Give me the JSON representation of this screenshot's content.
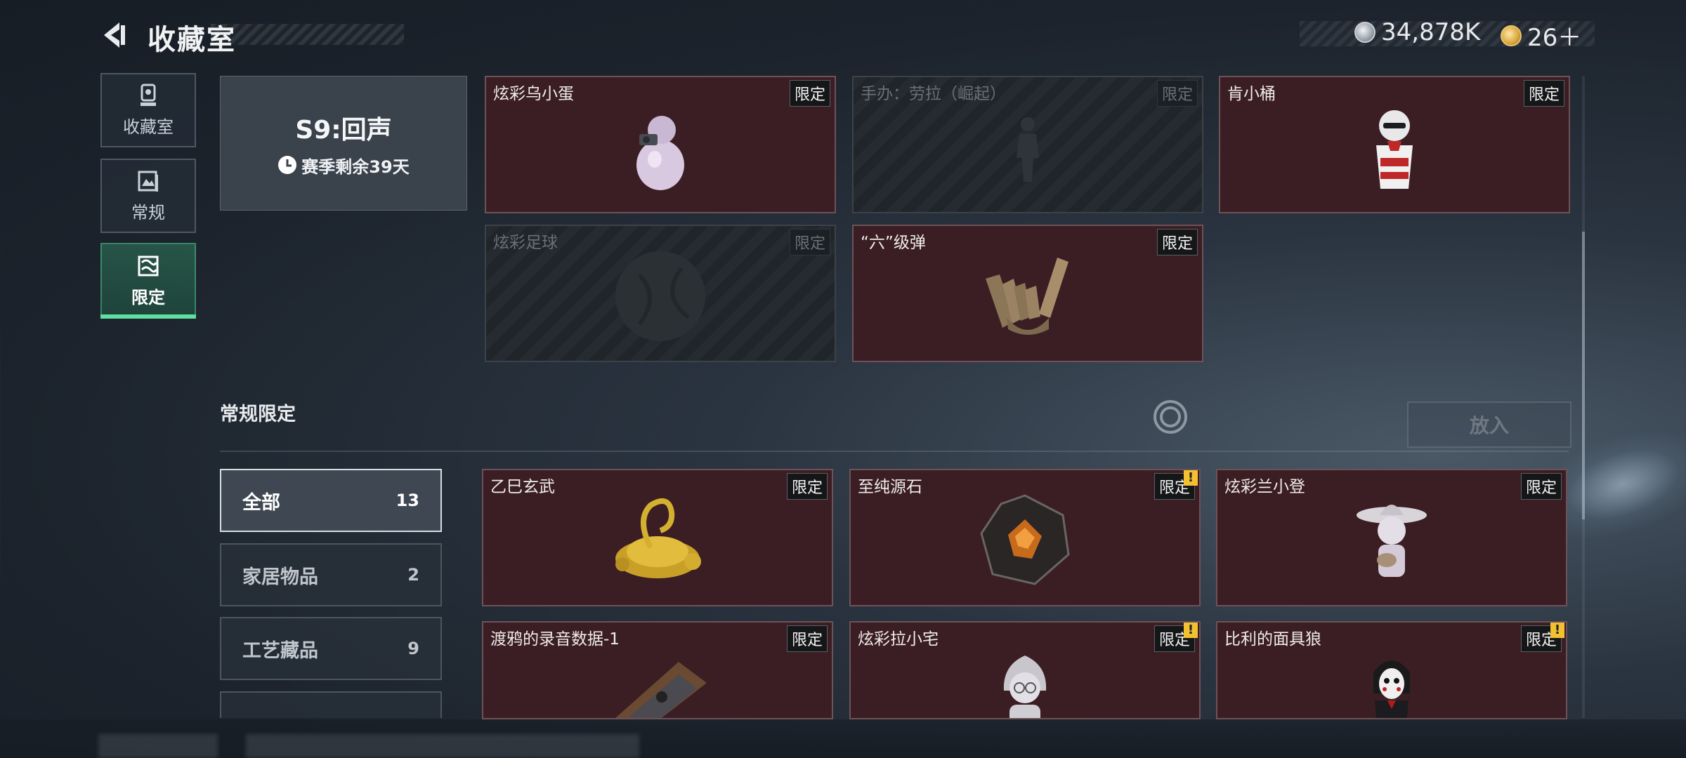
{
  "header": {
    "title": "收藏室",
    "currency_silver": "34,878K",
    "currency_gold": "26＋"
  },
  "nav": [
    {
      "label": "收藏室",
      "icon": "trophy-icon"
    },
    {
      "label": "常规",
      "icon": "frame-icon"
    },
    {
      "label": "限定",
      "icon": "limited-icon"
    }
  ],
  "season": {
    "title": "S9:回声",
    "remaining": "赛季剩余39天"
  },
  "season_items": [
    {
      "name": "炫彩乌小蛋",
      "tag": "限定",
      "locked": false,
      "alert": false,
      "icon": "egg-figure-icon"
    },
    {
      "name": "手办：劳拉（崛起）",
      "tag": "限定",
      "locked": true,
      "alert": false,
      "icon": "figure-silhouette-icon"
    },
    {
      "name": "肯小桶",
      "tag": "限定",
      "locked": false,
      "alert": false,
      "icon": "bucket-figure-icon"
    },
    {
      "name": "炫彩足球",
      "tag": "限定",
      "locked": true,
      "alert": false,
      "icon": "ball-silhouette-icon"
    },
    {
      "name": "“六”级弹",
      "tag": "限定",
      "locked": false,
      "alert": false,
      "icon": "bullet-hand-icon"
    }
  ],
  "section": {
    "title": "常规限定",
    "put_label": "放入"
  },
  "filters": [
    {
      "label": "全部",
      "count": "13"
    },
    {
      "label": "家居物品",
      "count": "2"
    },
    {
      "label": "工艺藏品",
      "count": "9"
    }
  ],
  "regular_items": [
    {
      "name": "乙巳玄武",
      "tag": "限定",
      "alert": false,
      "icon": "golden-turtle-icon"
    },
    {
      "name": "至纯源石",
      "tag": "限定",
      "alert": true,
      "icon": "crystal-stone-icon"
    },
    {
      "name": "炫彩兰小登",
      "tag": "限定",
      "alert": false,
      "icon": "sombrero-figure-icon"
    },
    {
      "name": "渡鸦的录音数据-1",
      "tag": "限定",
      "alert": false,
      "icon": "cassette-icon"
    },
    {
      "name": "炫彩拉小宅",
      "tag": "限定",
      "alert": true,
      "icon": "hooded-figure-icon"
    },
    {
      "name": "比利的面具狼",
      "tag": "限定",
      "alert": true,
      "icon": "puppet-mask-icon"
    }
  ],
  "colors": {
    "card_bg": "#3b1e23",
    "accent_green": "#5fe0a0",
    "alert_yellow": "#f2c030"
  }
}
